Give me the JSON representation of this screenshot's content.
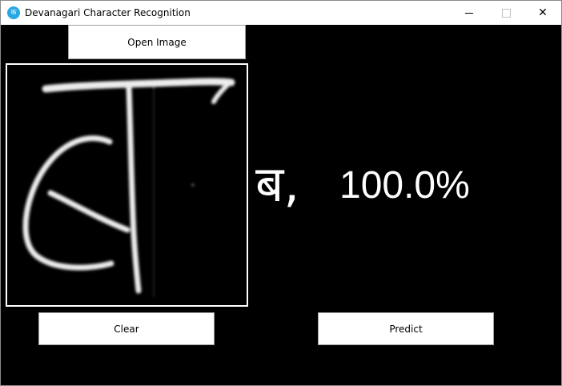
{
  "window": {
    "title": "Devanagari Character Recognition",
    "icon_glyph": "क",
    "icon": "app-icon",
    "close_glyph": "✕"
  },
  "toolbar": {
    "open_label": "Open Image",
    "clear_label": "Clear",
    "predict_label": "Predict"
  },
  "result": {
    "character": "ब,",
    "confidence": "100.0%"
  },
  "colors": {
    "background": "#000000",
    "accent": "#29a8e0"
  }
}
